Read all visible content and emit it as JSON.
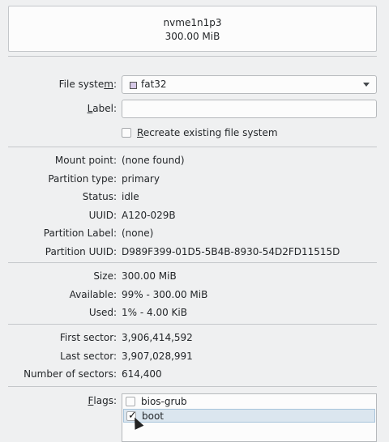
{
  "header": {
    "device": "nvme1n1p3",
    "size": "300.00 MiB"
  },
  "filesystem": {
    "label": "File system:",
    "value": "fat32",
    "swatch_color": "#d6c8e6"
  },
  "label_field": {
    "label": "Label:",
    "value": ""
  },
  "recreate": {
    "label": "Recreate existing file system",
    "checked": false
  },
  "info": [
    {
      "label": "Mount point:",
      "value": "(none found)"
    },
    {
      "label": "Partition type:",
      "value": "primary"
    },
    {
      "label": "Status:",
      "value": "idle"
    },
    {
      "label": "UUID:",
      "value": "A120-029B"
    },
    {
      "label": "Partition Label:",
      "value": "(none)"
    },
    {
      "label": "Partition UUID:",
      "value": "D989F399-01D5-5B4B-8930-54D2FD11515D"
    }
  ],
  "usage": [
    {
      "label": "Size:",
      "value": "300.00 MiB"
    },
    {
      "label": "Available:",
      "value": "99% - 300.00 MiB"
    },
    {
      "label": "Used:",
      "value": "1% - 4.00 KiB"
    }
  ],
  "sectors": [
    {
      "label": "First sector:",
      "value": "3,906,414,592"
    },
    {
      "label": "Last sector:",
      "value": "3,907,028,991"
    },
    {
      "label": "Number of sectors:",
      "value": "614,400"
    }
  ],
  "flags": {
    "label": "Flags:",
    "items": [
      {
        "name": "bios-grub",
        "checked": false
      },
      {
        "name": "boot",
        "checked": true,
        "checkmark": "✓"
      }
    ]
  }
}
